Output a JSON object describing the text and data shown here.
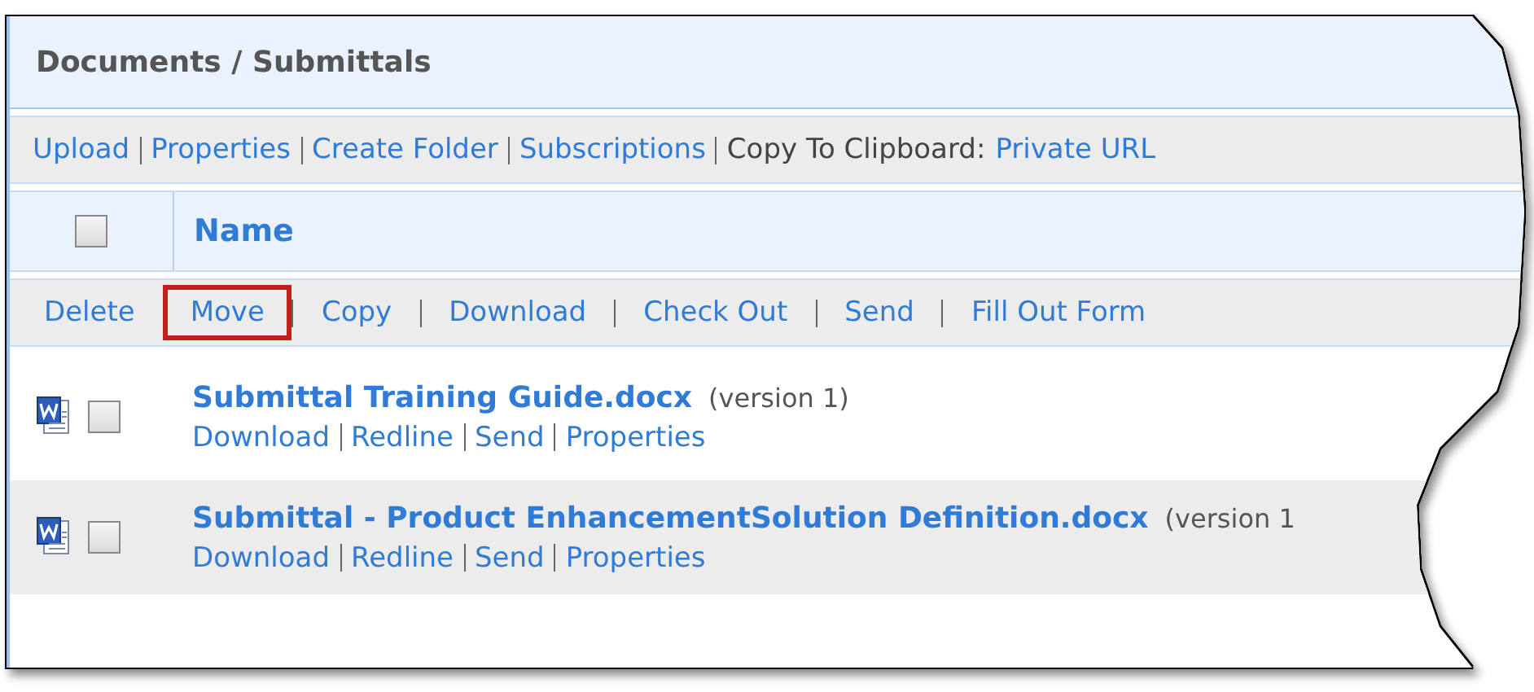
{
  "title": "Documents / Submittals",
  "toolbar": [
    {
      "kind": "link",
      "text": "Upload"
    },
    {
      "kind": "link",
      "text": "Properties"
    },
    {
      "kind": "link",
      "text": "Create Folder"
    },
    {
      "kind": "link",
      "text": "Subscriptions"
    },
    {
      "kind": "label",
      "text": "Copy To Clipboard:"
    },
    {
      "kind": "link",
      "text": "Private URL"
    }
  ],
  "header": {
    "select_all_checked": false,
    "column": "Name"
  },
  "actions": [
    {
      "text": "Delete",
      "highlighted": false
    },
    {
      "text": "Move",
      "highlighted": true
    },
    {
      "text": "Copy",
      "highlighted": false
    },
    {
      "text": "Download",
      "highlighted": false
    },
    {
      "text": "Check Out",
      "highlighted": false
    },
    {
      "text": "Send",
      "highlighted": false
    },
    {
      "text": "Fill Out Form",
      "highlighted": false
    }
  ],
  "files": [
    {
      "name": "Submittal Training Guide.docx",
      "version": "(version 1)",
      "checked": false,
      "links": [
        "Download",
        "Redline",
        "Send",
        "Properties"
      ]
    },
    {
      "name": "Submittal - Product EnhancementSolution Definition.docx",
      "version": "(version 1",
      "checked": false,
      "links": [
        "Download",
        "Redline",
        "Send",
        "Properties"
      ]
    }
  ]
}
